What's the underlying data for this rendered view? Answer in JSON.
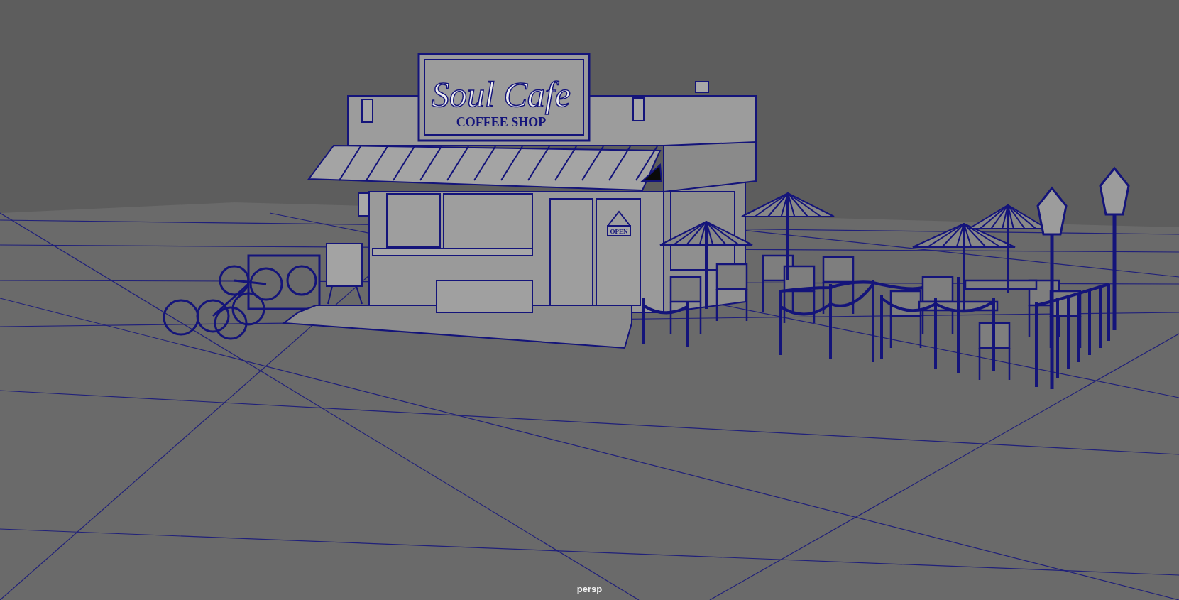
{
  "viewport": {
    "camera_label": "persp",
    "model": {
      "sign_title": "Soul Cafe",
      "sign_subtitle": "COFFEE SHOP",
      "door_sign": "OPEN"
    }
  }
}
